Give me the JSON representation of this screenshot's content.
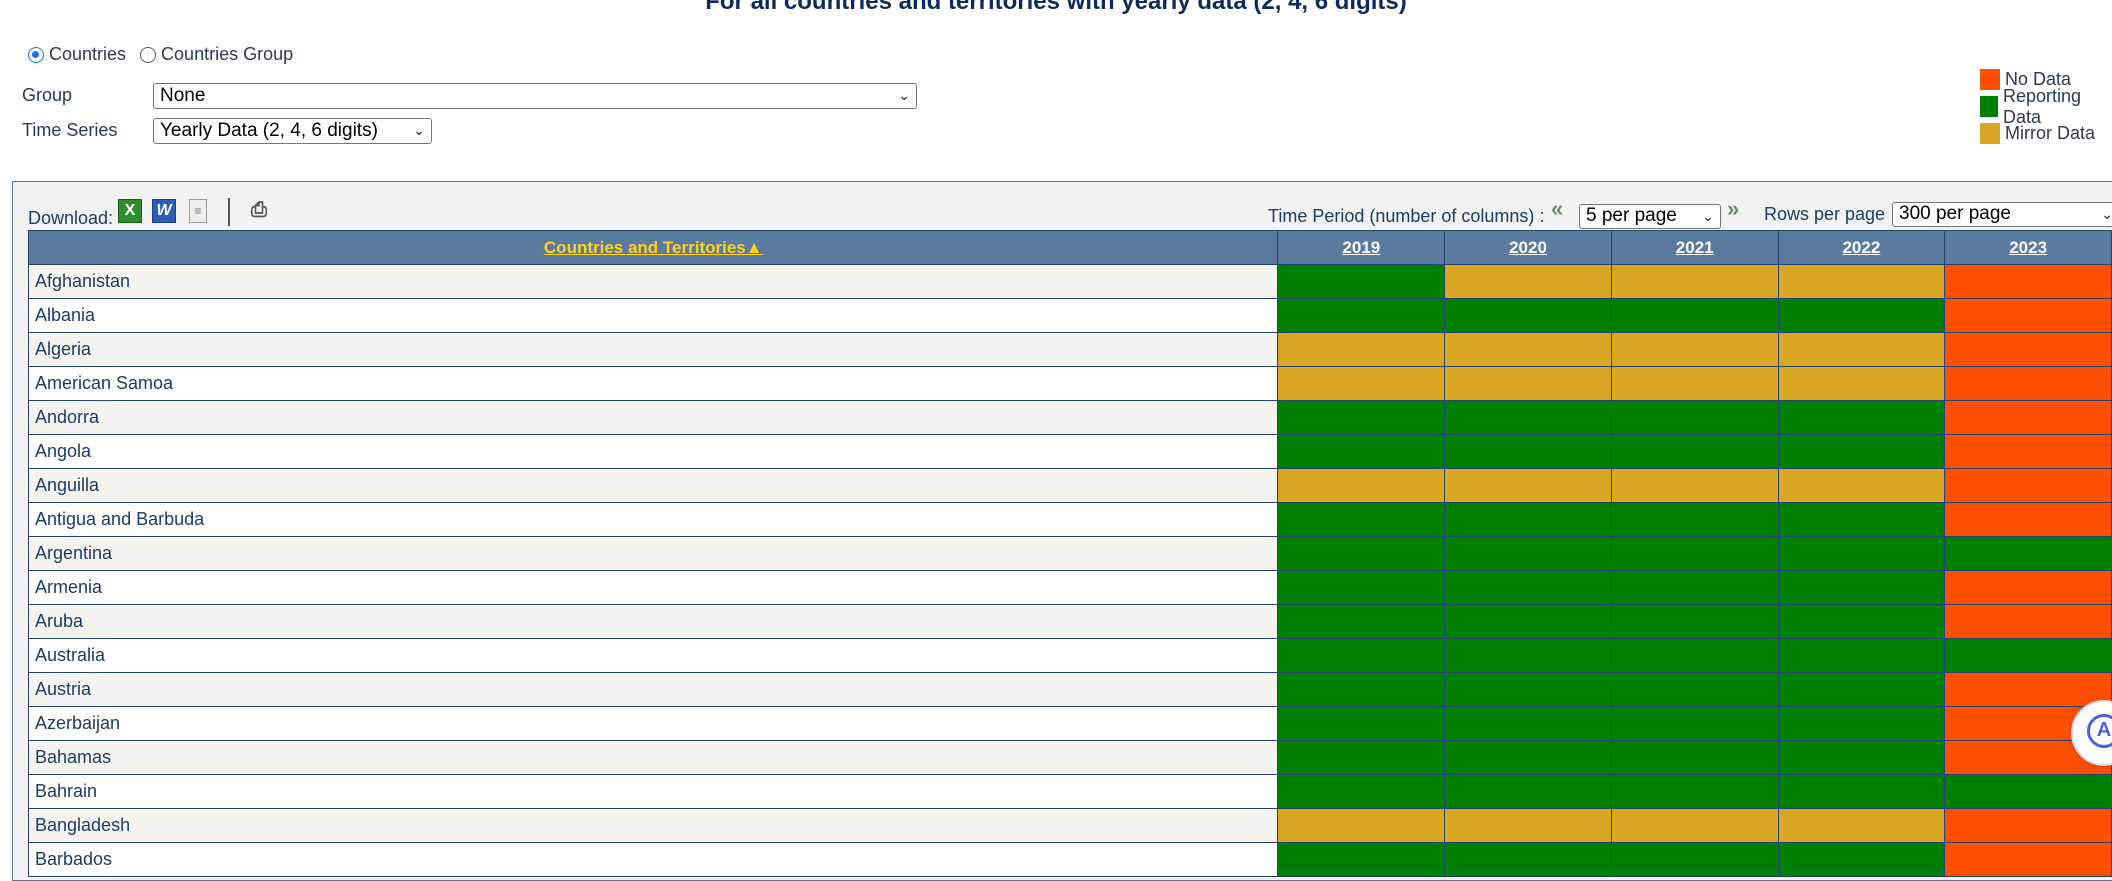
{
  "page_title": "For all countries and territories with yearly data (2, 4, 6 digits)",
  "scope": {
    "options": [
      {
        "label": "Countries",
        "selected": true
      },
      {
        "label": "Countries Group",
        "selected": false
      }
    ]
  },
  "filters": {
    "group_label": "Group",
    "group_value": "None",
    "time_series_label": "Time Series",
    "time_series_value": "Yearly Data (2, 4, 6 digits)"
  },
  "legend": [
    {
      "label": "No Data",
      "color": "#ff4f00"
    },
    {
      "label": "Reporting Data",
      "color": "#008000"
    },
    {
      "label": "Mirror Data",
      "color": "#daa520"
    }
  ],
  "toolbar": {
    "download_label": "Download:",
    "icons": [
      "excel-icon",
      "word-icon",
      "text-file-icon",
      "print-icon"
    ],
    "time_period_label": "Time Period (number of columns) :",
    "time_period_value": "5 per page",
    "rows_label": "Rows per page",
    "rows_value": "300 per page"
  },
  "table": {
    "country_header": "Countries and Territories",
    "sort_indicator": "▲",
    "years": [
      "2019",
      "2020",
      "2021",
      "2022",
      "2023"
    ],
    "status_colors": {
      "R": "#008000",
      "M": "#daa520",
      "N": "#ff4f00"
    },
    "rows": [
      {
        "name": "Afghanistan",
        "status": [
          "R",
          "M",
          "M",
          "M",
          "N"
        ]
      },
      {
        "name": "Albania",
        "status": [
          "R",
          "R",
          "R",
          "R",
          "N"
        ]
      },
      {
        "name": "Algeria",
        "status": [
          "M",
          "M",
          "M",
          "M",
          "N"
        ]
      },
      {
        "name": "American Samoa",
        "status": [
          "M",
          "M",
          "M",
          "M",
          "N"
        ]
      },
      {
        "name": "Andorra",
        "status": [
          "R",
          "R",
          "R",
          "R",
          "N"
        ]
      },
      {
        "name": "Angola",
        "status": [
          "R",
          "R",
          "R",
          "R",
          "N"
        ]
      },
      {
        "name": "Anguilla",
        "status": [
          "M",
          "M",
          "M",
          "M",
          "N"
        ]
      },
      {
        "name": "Antigua and Barbuda",
        "status": [
          "R",
          "R",
          "R",
          "R",
          "N"
        ]
      },
      {
        "name": "Argentina",
        "status": [
          "R",
          "R",
          "R",
          "R",
          "R"
        ]
      },
      {
        "name": "Armenia",
        "status": [
          "R",
          "R",
          "R",
          "R",
          "N"
        ]
      },
      {
        "name": "Aruba",
        "status": [
          "R",
          "R",
          "R",
          "R",
          "N"
        ]
      },
      {
        "name": "Australia",
        "status": [
          "R",
          "R",
          "R",
          "R",
          "R"
        ]
      },
      {
        "name": "Austria",
        "status": [
          "R",
          "R",
          "R",
          "R",
          "N"
        ]
      },
      {
        "name": "Azerbaijan",
        "status": [
          "R",
          "R",
          "R",
          "R",
          "N"
        ]
      },
      {
        "name": "Bahamas",
        "status": [
          "R",
          "R",
          "R",
          "R",
          "N"
        ]
      },
      {
        "name": "Bahrain",
        "status": [
          "R",
          "R",
          "R",
          "R",
          "R"
        ]
      },
      {
        "name": "Bangladesh",
        "status": [
          "M",
          "M",
          "M",
          "M",
          "N"
        ]
      },
      {
        "name": "Barbados",
        "status": [
          "R",
          "R",
          "R",
          "R",
          "N"
        ]
      }
    ]
  },
  "help_bubble_letter": "A"
}
